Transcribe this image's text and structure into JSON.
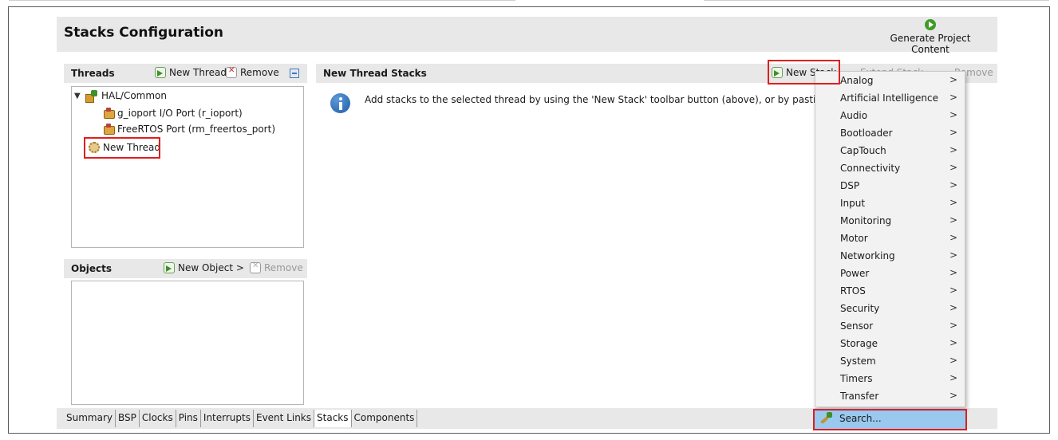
{
  "header": {
    "title": "Stacks Configuration",
    "generate_label": "Generate Project Content"
  },
  "threads": {
    "title": "Threads",
    "new_thread_label": "New Thread",
    "remove_label": "Remove",
    "tree": {
      "group": "HAL/Common",
      "children": [
        "g_ioport I/O Port (r_ioport)",
        "FreeRTOS Port (rm_freertos_port)"
      ],
      "new_thread": "New Thread"
    }
  },
  "objects": {
    "title": "Objects",
    "new_object_label": "New Object >",
    "remove_label": "Remove"
  },
  "stacks": {
    "title": "New Thread Stacks",
    "new_stack_label": "New Stack",
    "extend_stack_label": "Extend Stack",
    "remove_label": "Remove",
    "info": "Add stacks to the selected thread by using the 'New Stack' toolbar button (above), or by pasting here"
  },
  "menu": {
    "items": [
      "Analog",
      "Artificial Intelligence",
      "Audio",
      "Bootloader",
      "CapTouch",
      "Connectivity",
      "DSP",
      "Input",
      "Monitoring",
      "Motor",
      "Networking",
      "Power",
      "RTOS",
      "Security",
      "Sensor",
      "Storage",
      "System",
      "Timers",
      "Transfer"
    ],
    "submenu_arrow": ">",
    "search": "Search..."
  },
  "tabs": [
    "Summary",
    "BSP",
    "Clocks",
    "Pins",
    "Interrupts",
    "Event Links",
    "Stacks",
    "Components"
  ],
  "active_tab": "Stacks",
  "colors": {
    "highlight": "#e01e1e",
    "menu_selected": "#99c9ef",
    "panel_header": "#e8e8e8"
  }
}
